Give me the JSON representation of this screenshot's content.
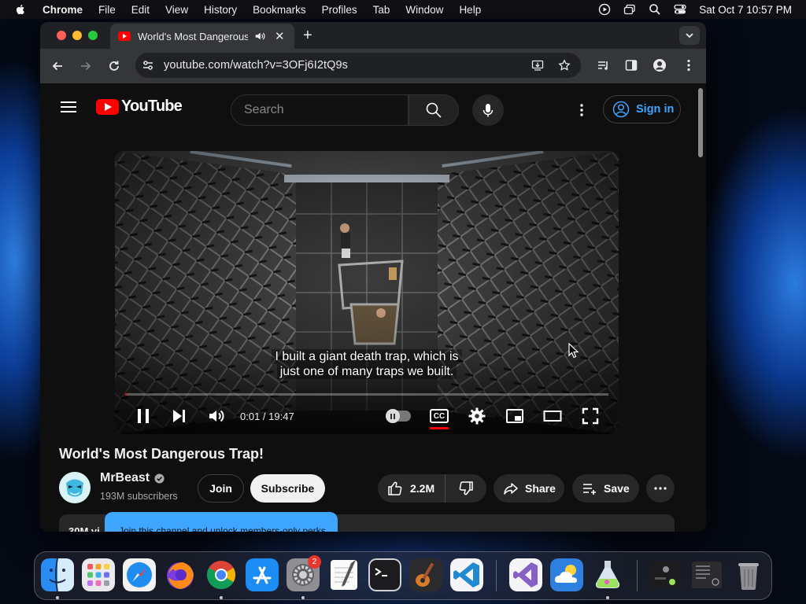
{
  "menubar": {
    "app_name": "Chrome",
    "items": [
      "File",
      "Edit",
      "View",
      "History",
      "Bookmarks",
      "Profiles",
      "Tab",
      "Window",
      "Help"
    ],
    "datetime": "Sat Oct 7  10:57 PM"
  },
  "browser": {
    "tab_title": "World's Most Dangerous Trap!",
    "new_tab_label": "+",
    "url": "youtube.com/watch?v=3OFj6I2tQ9s"
  },
  "youtube": {
    "wordmark": "YouTube",
    "search_placeholder": "Search",
    "signin_label": "Sign in",
    "player": {
      "caption_line1": "I built a giant death trap, which is",
      "caption_line2": "just one of many traps we built.",
      "time": "0:01 / 19:47",
      "progress_fraction": 0.001,
      "cc_label": "CC"
    },
    "video_title": "World's Most Dangerous Trap!",
    "channel_name": "MrBeast",
    "subscribers": "193M subscribers",
    "join_label": "Join",
    "subscribe_label": "Subscribe",
    "like_count": "2.2M",
    "share_label": "Share",
    "save_label": "Save",
    "description_views": "30M vi",
    "tooltip_text": "Join this channel and unlock members-only perks"
  },
  "dock": {
    "badge_count": "2",
    "apps": [
      "Finder",
      "Launchpad",
      "Safari",
      "Firefox",
      "Chrome",
      "App Store",
      "System Settings",
      "TextEdit",
      "Terminal",
      "GarageBand",
      "Visual Studio Code",
      "Visual Studio",
      "Weather",
      "Potion",
      "Preview",
      "Screenshots",
      "Trash"
    ]
  },
  "colors": {
    "yt_red": "#ff0000",
    "link_blue": "#3ea6ff",
    "page_bg": "#0f0f0f"
  }
}
